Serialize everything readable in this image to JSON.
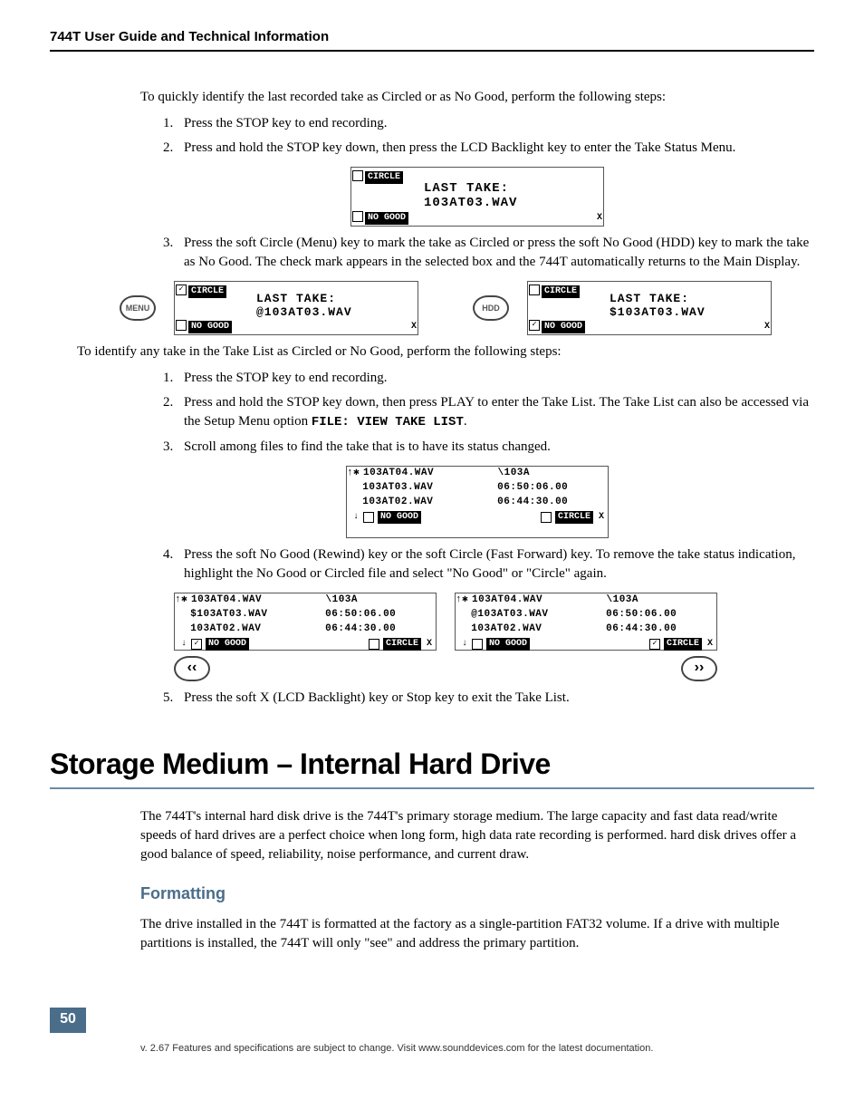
{
  "header": "744T User Guide and Technical Information",
  "intro1": "To quickly identify the last recorded take as Circled or as No Good, perform the following steps:",
  "steps_a": {
    "s1": "Press the STOP key to end recording.",
    "s2": "Press and hold the STOP key down, then press the LCD Backlight key to enter the Take Status Menu.",
    "s3": "Press the soft Circle (Menu) key to mark the take as Circled or press the soft No Good (HDD) key to mark the take as No Good. The check mark appears in the selected box and the 744T automatically returns to the Main Display."
  },
  "intro2": "To identify any take in the Take List as Circled or No Good, perform the following steps:",
  "steps_b": {
    "s1": "Press the STOP key to end recording.",
    "s2_a": "Press and hold the STOP key down, then press PLAY to enter the Take List. The Take List can also be accessed via the  Setup Menu option  ",
    "s2_b": "FILE: VIEW TAKE LIST",
    "s2_c": ".",
    "s3": "Scroll among files to find the take that is to have its status changed.",
    "s4_a": "Press the soft No Good (Rewind) key or the soft Circle (Fast Forward) key. ",
    "s4_b": "To remove the take status indication, highlight the No Good or Circled file and select \"No Good\" or \"Circle\" again.",
    "s5": "Press the soft X (LCD Backlight) key or Stop key to exit the Take List."
  },
  "lcd": {
    "circle": "CIRCLE",
    "nogood": "NO GOOD",
    "last_take": "LAST TAKE:",
    "file": "103AT03.WAV",
    "file_at": "@103AT03.WAV",
    "file_dollar": "$103AT03.WAV",
    "x": "X",
    "check": "✓"
  },
  "btn": {
    "menu": "MENU",
    "hdd": "HDD",
    "rew": "‹‹",
    "ff": "››"
  },
  "takelist": {
    "r1_fn": "103AT04.WAV",
    "r1_tm": "\\103A",
    "r2_fn": "103AT03.WAV",
    "r2_tm": "06:50:06.00",
    "r2d_fn": "$103AT03.WAV",
    "r2a_fn": "@103AT03.WAV",
    "r3_fn": "103AT02.WAV",
    "r3_tm": "06:44:30.00",
    "nogood": "NO GOOD",
    "circle": "CIRCLE"
  },
  "h1": "Storage Medium – Internal Hard Drive",
  "para1": "The 744T's internal hard disk drive is the 744T's primary storage medium. The large capacity and fast data read/write speeds of hard drives are a perfect choice when long form, high data rate recording is performed. hard disk drives offer a good balance of speed, reliability, noise performance, and current draw.",
  "h2": "Formatting",
  "para2": "The drive installed in the 744T is formatted at the factory as a single-partition FAT32 volume. If a drive with multiple partitions is installed, the 744T will only \"see\" and address the primary partition.",
  "page": "50",
  "footer": "v. 2.67      Features and specifications are subject to change. Visit www.sounddevices.com for the latest documentation."
}
